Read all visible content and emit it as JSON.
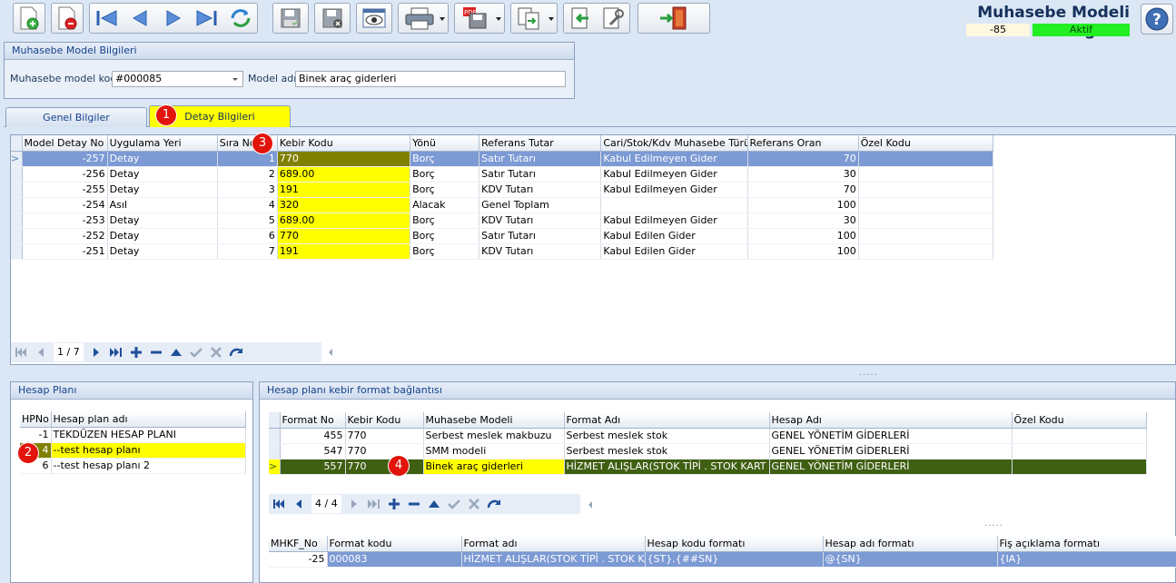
{
  "app": {
    "title": "Muhasebe Modeli Bilgileri",
    "record_id": "-85",
    "status": "Aktif",
    "status_color": "#22ee22"
  },
  "toolbar": {
    "buttons": [
      "new-record-icon",
      "delete-record-icon",
      "first-record-icon",
      "previous-record-icon",
      "next-record-icon",
      "last-record-icon",
      "refresh-icon",
      "save-icon",
      "save-and-close-icon",
      "preview-icon",
      "print-icon",
      "pdf-export-icon",
      "export-icon",
      "back-icon",
      "tools-icon",
      "exit-icon",
      "help-icon"
    ]
  },
  "header_panel": {
    "title": "Muhasebe Model Bilgileri",
    "model_code_label": "Muhasebe model kodu",
    "model_code_value": "#000085",
    "model_name_label": "Model adı",
    "model_name_value": "Binek araç giderleri"
  },
  "tabs": [
    {
      "label": "Genel Bilgiler"
    },
    {
      "label": "Detay Bilgileri"
    }
  ],
  "detail_grid": {
    "columns": [
      "Model Detay No",
      "Uygulama Yeri",
      "Sıra No",
      "Kebir Kodu",
      "Yönü",
      "Referans Tutar",
      "Cari/Stok/Kdv Muhasebe Türü",
      "Referans Oran",
      "Özel Kodu"
    ],
    "rows": [
      [
        "-257",
        "Detay",
        "1",
        "770",
        "Borç",
        "Satır Tutarı",
        "Kabul Edilmeyen Gider",
        "70",
        ""
      ],
      [
        "-256",
        "Detay",
        "2",
        "689.00",
        "Borç",
        "Satır Tutarı",
        "Kabul Edilmeyen Gider",
        "30",
        ""
      ],
      [
        "-255",
        "Detay",
        "3",
        "191",
        "Borç",
        "KDV Tutarı",
        "Kabul Edilmeyen Gider",
        "70",
        ""
      ],
      [
        "-254",
        "Asıl",
        "4",
        "320",
        "Alacak",
        "Genel Toplam",
        "",
        "100",
        ""
      ],
      [
        "-253",
        "Detay",
        "5",
        "689.00",
        "Borç",
        "KDV Tutarı",
        "Kabul Edilmeyen Gider",
        "30",
        ""
      ],
      [
        "-252",
        "Detay",
        "6",
        "770",
        "Borç",
        "Satır Tutarı",
        "Kabul Edilen Gider",
        "100",
        ""
      ],
      [
        "-251",
        "Detay",
        "7",
        "191",
        "Borç",
        "KDV Tutarı",
        "Kabul Edilen Gider",
        "100",
        ""
      ]
    ],
    "navigator_position": "1 / 7"
  },
  "hesap_plani": {
    "title": "Hesap Planı",
    "columns": [
      "HPNo",
      "Hesap plan adı"
    ],
    "rows": [
      [
        "-1",
        "TEKDÜZEN HESAP PLANI"
      ],
      [
        "4",
        "--test hesap planı"
      ],
      [
        "6",
        "--test hesap planı 2"
      ]
    ]
  },
  "format_link": {
    "title": "Hesap planı kebir format bağlantısı",
    "columns": [
      "Format No",
      "Kebir Kodu",
      "Muhasebe Modeli",
      "Format Adı",
      "Hesap Adı",
      "Özel Kodu"
    ],
    "rows": [
      [
        "455",
        "770",
        "Serbest meslek makbuzu",
        "Serbest meslek stok",
        "GENEL YÖNETİM GİDERLERİ",
        ""
      ],
      [
        "547",
        "770",
        "SMM modeli",
        "Serbest meslek stok",
        "GENEL YÖNETİM GİDERLERİ",
        ""
      ],
      [
        "557",
        "770",
        "Binek araç giderleri",
        "HİZMET ALIŞLAR(STOK TİPİ . STOK KART NO)",
        "GENEL YÖNETİM GİDERLERİ",
        ""
      ]
    ],
    "navigator_position": "4 / 4"
  },
  "mhkf_grid": {
    "columns": [
      "MHKF_No",
      "Format kodu",
      "Format adı",
      "Hesap kodu formatı",
      "Hesap adı formatı",
      "Fiş açıklama formatı"
    ],
    "rows": [
      [
        "-25",
        "000083",
        "HİZMET ALIŞLAR(STOK TİPİ . STOK KART",
        "{ST}.{##SN}",
        "@{SN}",
        "{IA}"
      ]
    ]
  },
  "callouts": [
    "1",
    "2",
    "3",
    "4"
  ]
}
